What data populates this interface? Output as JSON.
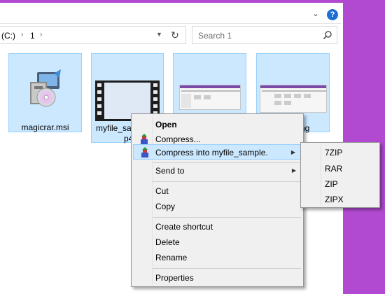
{
  "window": {
    "accent_color": "#b14ad1"
  },
  "ribbon": {
    "collapse_icon": "chevron-down-icon",
    "help_label": "?"
  },
  "address": {
    "drive": "(C:)",
    "folder": "1",
    "separator": "›"
  },
  "search": {
    "placeholder": "Search 1"
  },
  "files": [
    {
      "label": "magicrar.msi"
    },
    {
      "label": "myfile_sa",
      "label_line2": "p4"
    },
    {
      "label": ""
    },
    {
      "label": "ng"
    }
  ],
  "context_menu": {
    "items": [
      {
        "label": "Open"
      },
      {
        "label": "Compress..."
      },
      {
        "label": "Compress into myfile_sample."
      },
      {
        "label": "Send to"
      },
      {
        "label": "Cut"
      },
      {
        "label": "Copy"
      },
      {
        "label": "Create shortcut"
      },
      {
        "label": "Delete"
      },
      {
        "label": "Rename"
      },
      {
        "label": "Properties"
      }
    ],
    "highlight_color": "#cce8ff"
  },
  "submenu": {
    "items": [
      "7ZIP",
      "RAR",
      "ZIP",
      "ZIPX"
    ]
  }
}
